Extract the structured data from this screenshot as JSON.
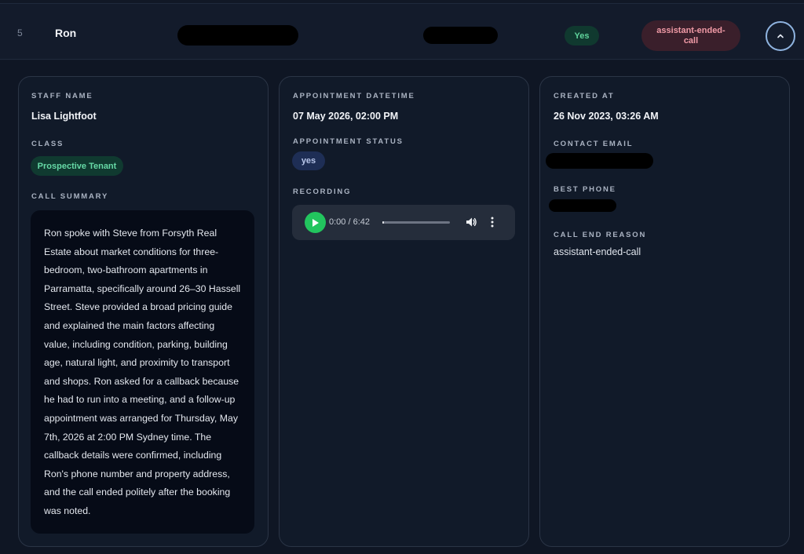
{
  "row": {
    "index": "5",
    "name": "Ron",
    "success_badge": "Yes",
    "end_reason_badge": "assistant-ended-call",
    "colors": {
      "success": "#5fd39b",
      "reason": "#f09aa6"
    }
  },
  "staff_card": {
    "staff_name_label": "STAFF NAME",
    "staff_name": "Lisa Lightfoot",
    "class_label": "CLASS",
    "class_value": "Prospective Tenant",
    "summary_label": "CALL SUMMARY",
    "summary": "Ron spoke with Steve from Forsyth Real Estate about market conditions for three-bedroom, two-bathroom apartments in Parramatta, specifically around 26–30 Hassell Street. Steve provided a broad pricing guide and explained the main factors affecting value, including condition, parking, building age, natural light, and proximity to transport and shops. Ron asked for a callback because he had to run into a meeting, and a follow-up appointment was arranged for Thursday, May 7th, 2026 at 2:00 PM Sydney time. The callback details were confirmed, including Ron's phone number and property address, and the call ended politely after the booking was noted."
  },
  "appointment_card": {
    "datetime_label": "APPOINTMENT DATETIME",
    "datetime": "07 May 2026, 02:00 PM",
    "status_label": "APPOINTMENT STATUS",
    "status": "yes",
    "recording_label": "RECORDING",
    "player": {
      "time": "0:00 / 6:42",
      "progress": 0.02,
      "play_icon": "play-icon",
      "volume_icon": "volume-icon",
      "more_icon": "more-options-icon"
    }
  },
  "meta_card": {
    "created_label": "CREATED AT",
    "created": "26 Nov 2023, 03:26 AM",
    "email_label": "CONTACT EMAIL",
    "phone_label": "BEST PHONE",
    "end_reason_label": "CALL END REASON",
    "end_reason": "assistant-ended-call"
  }
}
